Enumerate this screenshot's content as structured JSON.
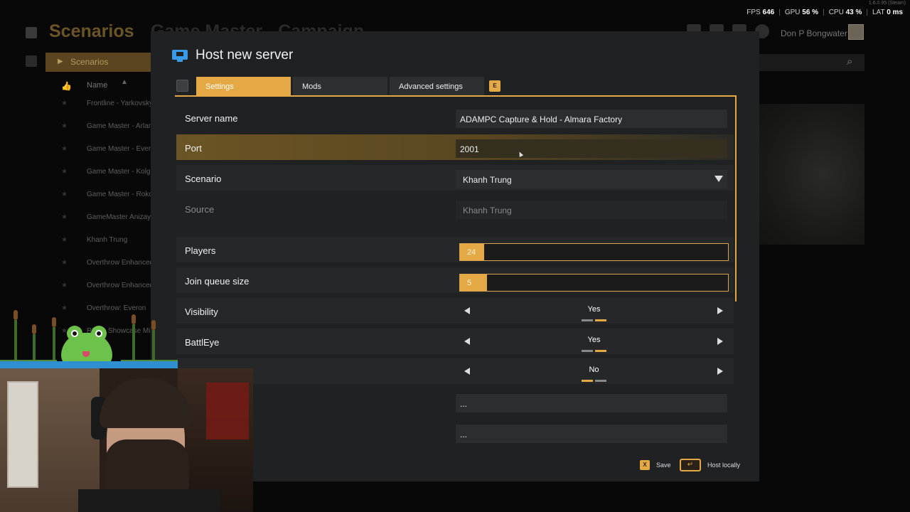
{
  "stats": {
    "version": "1.6.0.95 (Steam)",
    "fps_label": "FPS",
    "fps_value": "646",
    "gpu_label": "GPU",
    "gpu_value": "56 %",
    "cpu_label": "CPU",
    "cpu_value": "43 %",
    "lat_label": "LAT",
    "lat_value": "0 ms"
  },
  "background": {
    "title": "Scenarios",
    "subtitle": "Game Master - Campaign",
    "tab": "Scenarios",
    "column_name": "Name",
    "user_name": "Don P Bongwater",
    "list": [
      "Frontline - Yarkovsky",
      "Game Master - Arland",
      "Game Master - Everon",
      "Game Master - Kolguyev",
      "Game Master - Rokos",
      "GameMaster Anizay",
      "Khanh Trung",
      "Overthrow Enhanced:",
      "Overthrow Enhanced:",
      "Overthrow: Everon",
      "RHS - Showcase Mis"
    ]
  },
  "dialog": {
    "title": "Host new server",
    "tabs": [
      "Settings",
      "Mods",
      "Advanced settings"
    ],
    "tab_key": "E",
    "fields": {
      "server_name_label": "Server name",
      "server_name_value": "ADAMPC Capture & Hold - Almara Factory",
      "port_label": "Port",
      "port_value": "2001",
      "scenario_label": "Scenario",
      "scenario_value": "Khanh Trung",
      "source_label": "Source",
      "source_value": "Khanh Trung",
      "players_label": "Players",
      "players_value": "24",
      "join_queue_label": "Join queue size",
      "join_queue_value": "5",
      "visibility_label": "Visibility",
      "visibility_value": "Yes",
      "battleye_label": "BattlEye",
      "battleye_value": "Yes",
      "crossplay_value": "No",
      "password_value": "...",
      "admin_password_value": "..."
    },
    "sliders": {
      "players_fraction": 0.09,
      "join_queue_fraction": 0.1
    },
    "footer": {
      "save_key": "X",
      "save_label": "Save",
      "host_label": "Host locally"
    }
  },
  "colors": {
    "accent": "#e4a845",
    "dialog_bg": "#1f2122",
    "row_bg": "#252728"
  }
}
